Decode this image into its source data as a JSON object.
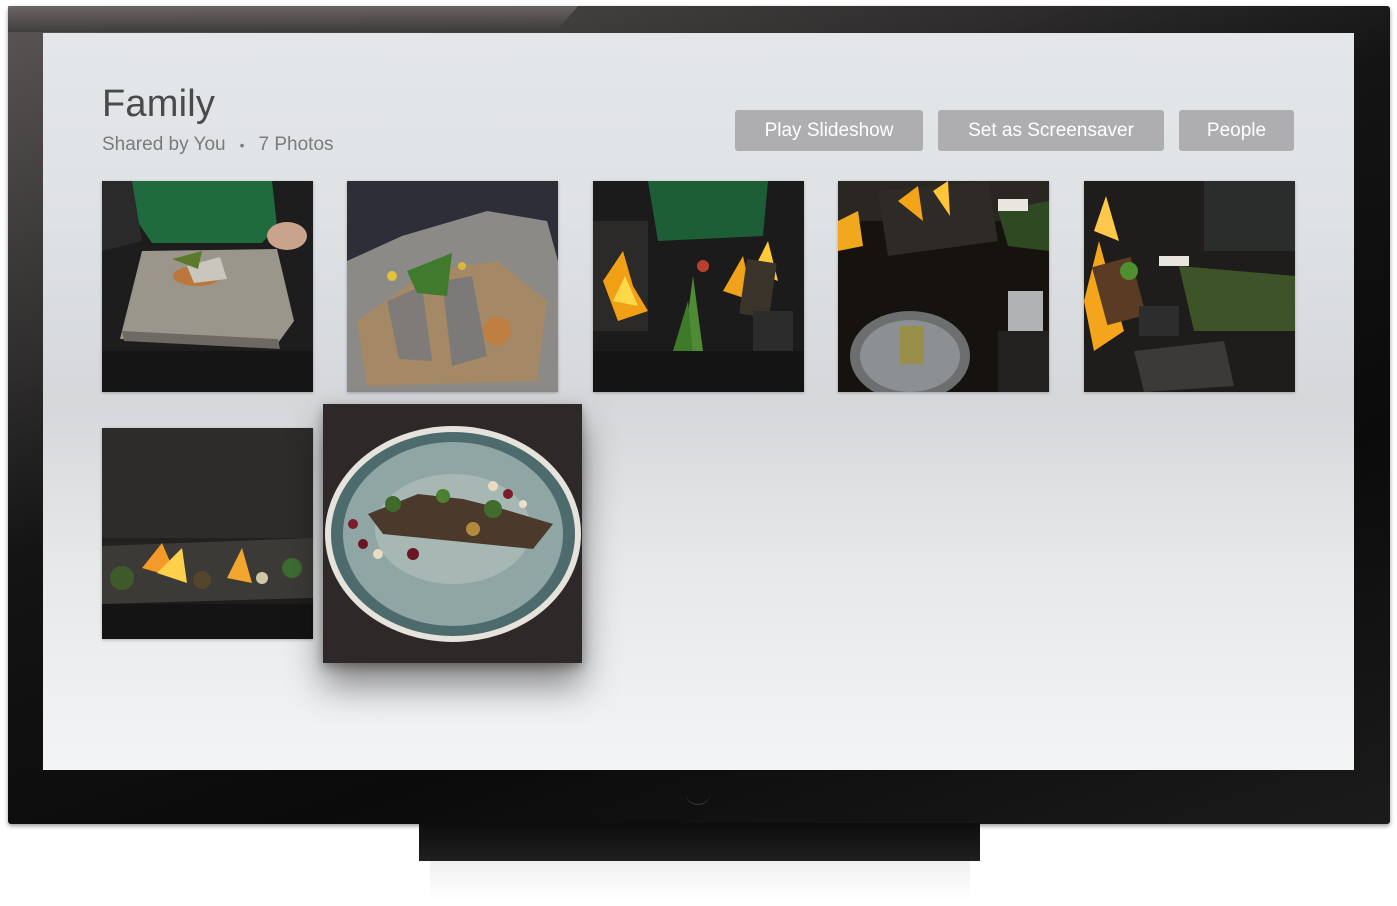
{
  "album": {
    "title": "Family",
    "shared_by": "Shared by You",
    "photo_count": "7 Photos"
  },
  "actions": {
    "play_slideshow": "Play Slideshow",
    "set_screensaver": "Set as Screensaver",
    "people": "People"
  },
  "photos": [
    {
      "subject": "stone slab dish"
    },
    {
      "subject": "stone dish close-up"
    },
    {
      "subject": "fire and greens"
    },
    {
      "subject": "table with plate"
    },
    {
      "subject": "fire and herbs"
    },
    {
      "subject": "long plate with flowers"
    },
    {
      "subject": "round plate dish"
    }
  ],
  "focused_photo_index": 6
}
